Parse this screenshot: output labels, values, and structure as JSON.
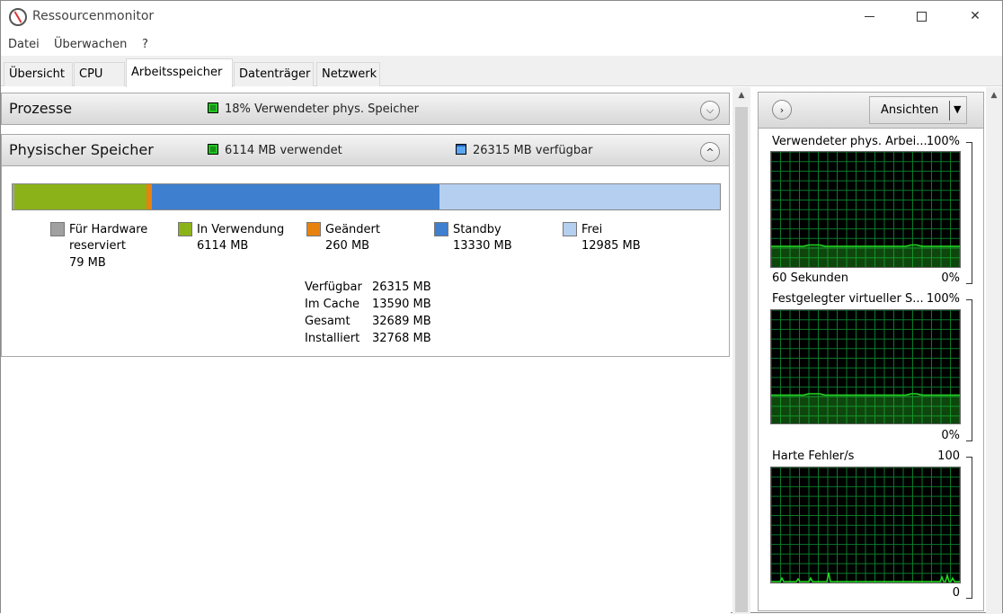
{
  "window": {
    "title": "Ressourcenmonitor",
    "minimize": "–",
    "maximize": "□",
    "close": "✕"
  },
  "menu": [
    "Datei",
    "Überwachen",
    "?"
  ],
  "tabs": [
    "Übersicht",
    "CPU",
    "Arbeitsspeicher",
    "Datenträger",
    "Netzwerk"
  ],
  "active_tab": "Arbeitsspeicher",
  "processes": {
    "title": "Prozesse",
    "info": "18% Verwendeter phys. Speicher"
  },
  "physical": {
    "title": "Physischer Speicher",
    "used_info": "6114 MB verwendet",
    "available_info": "26315 MB verfügbar",
    "bar": [
      {
        "label": "Für Hardware reserviert",
        "mb": 79,
        "color": "#a0a0a0"
      },
      {
        "label": "In Verwendung",
        "mb": 6114,
        "color": "#8cb21a"
      },
      {
        "label": "Geändert",
        "mb": 260,
        "color": "#e8820e"
      },
      {
        "label": "Standby",
        "mb": 13330,
        "color": "#3f7fcf"
      },
      {
        "label": "Frei",
        "mb": 12985,
        "color": "#b4cff0"
      }
    ],
    "legend": {
      "hardware": {
        "label1": "Für Hardware",
        "label2": "reserviert",
        "value": "79 MB"
      },
      "inuse": {
        "label": "In Verwendung",
        "value": "6114 MB"
      },
      "modified": {
        "label": "Geändert",
        "value": "260 MB"
      },
      "standby": {
        "label": "Standby",
        "value": "13330 MB"
      },
      "free": {
        "label": "Frei",
        "value": "12985 MB"
      }
    },
    "stats": [
      {
        "key": "Verfügbar",
        "value": "26315 MB"
      },
      {
        "key": "Im Cache",
        "value": "13590 MB"
      },
      {
        "key": "Gesamt",
        "value": "32689 MB"
      },
      {
        "key": "Installiert",
        "value": "32768 MB"
      }
    ]
  },
  "side": {
    "views_label": "Ansichten",
    "graphs": [
      {
        "title": "Verwendeter phys. Arbei...",
        "max": "100%",
        "min": "0%",
        "foot": "60 Sekunden",
        "level": 0.18,
        "color": "#22dd22"
      },
      {
        "title": "Festgelegter virtueller S...",
        "max": "100%",
        "min": "0%",
        "foot": "",
        "level": 0.25,
        "color": "#22dd22"
      },
      {
        "title": "Harte Fehler/s",
        "max": "100",
        "min": "0",
        "foot": "",
        "level": 0.0,
        "color": "#22dd22"
      }
    ]
  }
}
